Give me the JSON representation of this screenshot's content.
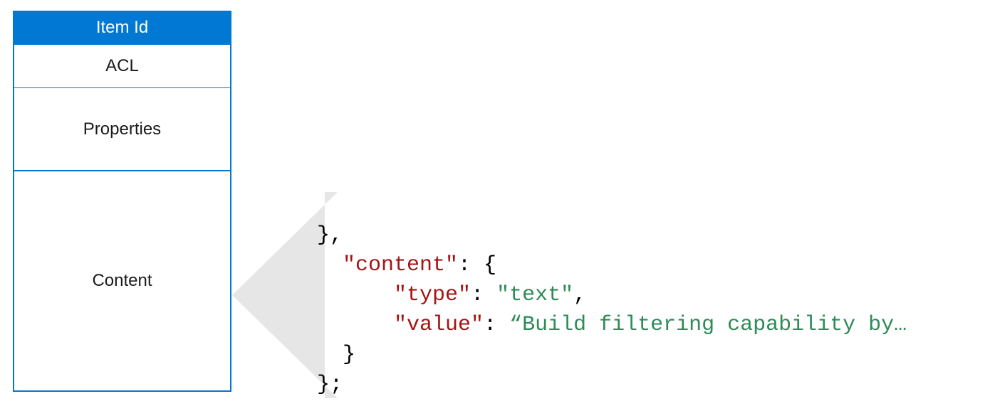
{
  "panel": {
    "header": "Item Id",
    "cells": {
      "acl": "ACL",
      "properties": "Properties",
      "content": "Content"
    }
  },
  "code": {
    "line1_punc": "},",
    "line2_key": "\"content\"",
    "line2_punc": ": {",
    "line3_key": "\"type\"",
    "line3_punc1": ": ",
    "line3_val": "\"text\"",
    "line3_punc2": ",",
    "line4_key": "\"value\"",
    "line4_punc1": ": ",
    "line4_val": "“Build filtering capability by…",
    "line5_punc": "}",
    "line6_punc": "};"
  }
}
